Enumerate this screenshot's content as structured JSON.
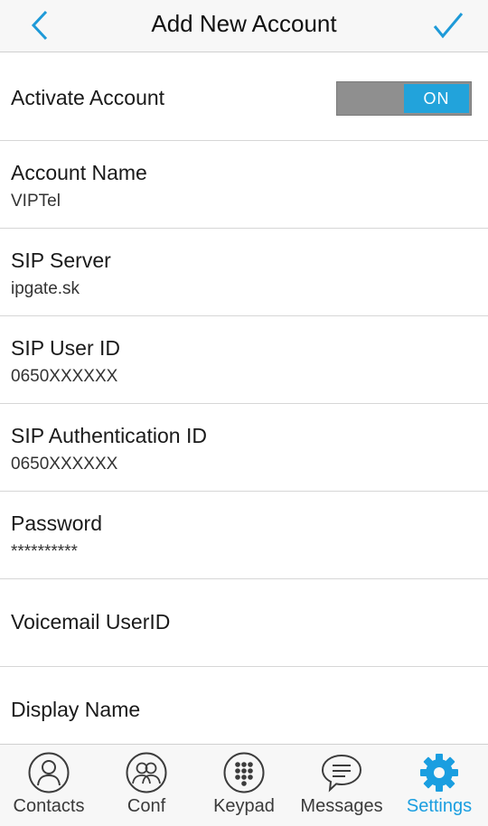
{
  "header": {
    "title": "Add New Account",
    "back_icon": "chevron-left-icon",
    "done_icon": "check-icon"
  },
  "activate": {
    "label": "Activate Account",
    "toggle_text": "ON",
    "on": true
  },
  "fields": {
    "account_name": {
      "label": "Account Name",
      "value": "VIPTel"
    },
    "sip_server": {
      "label": "SIP Server",
      "value": "ipgate.sk"
    },
    "sip_user_id": {
      "label": "SIP User ID",
      "value": "0650XXXXXX"
    },
    "sip_auth_id": {
      "label": "SIP Authentication ID",
      "value": "0650XXXXXX"
    },
    "password": {
      "label": "Password",
      "value": "**********"
    },
    "voicemail_userid": {
      "label": "Voicemail UserID"
    },
    "display_name": {
      "label": "Display Name"
    }
  },
  "tabs": [
    {
      "label": "Contacts",
      "icon": "contact-icon",
      "active": false
    },
    {
      "label": "Conf",
      "icon": "conference-icon",
      "active": false
    },
    {
      "label": "Keypad",
      "icon": "keypad-icon",
      "active": false
    },
    {
      "label": "Messages",
      "icon": "chat-bubble-icon",
      "active": false
    },
    {
      "label": "Settings",
      "icon": "gear-icon",
      "active": true
    }
  ],
  "colors": {
    "accent": "#22a3db",
    "tab_active": "#1a9ee0",
    "toggle_track": "#8f8f8f",
    "header_bg": "#f7f7f7"
  }
}
